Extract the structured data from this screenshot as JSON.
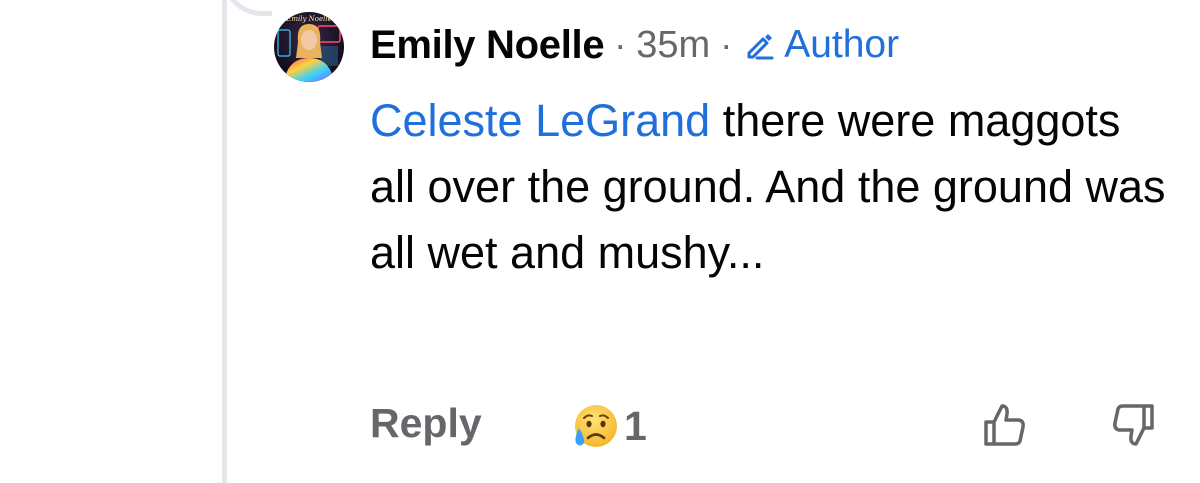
{
  "comment": {
    "author": "Emily Noelle",
    "separator": "·",
    "time": "35m",
    "badge_label": "Author",
    "badge_icon": "pencil-icon",
    "mention": "Celeste LeGrand",
    "text": " there were maggots all over the ground. And the ground was all wet and mushy...",
    "avatar_text": "Emily Noelle",
    "reply_label": "Reply",
    "reaction": {
      "icon": "sad-face-icon",
      "count": "1"
    },
    "upvote_icon": "thumbs-up-icon",
    "downvote_icon": "thumbs-down-icon"
  },
  "colors": {
    "link": "#216fdb",
    "text": "#050505",
    "secondary": "#65676b",
    "thread_line": "#e4e6eb"
  }
}
